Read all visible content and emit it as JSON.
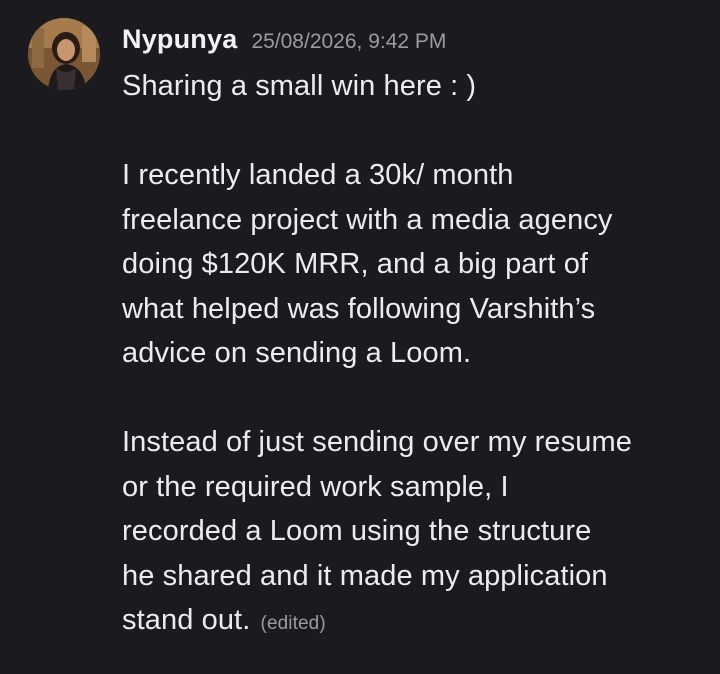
{
  "message": {
    "author": "Nypunya",
    "timestamp": "25/08/2026, 9:42 PM",
    "paragraphs": [
      [
        "Sharing a small win here : )"
      ],
      [
        "I recently landed a 30k/ month",
        "freelance project with a media agency",
        "doing $120K MRR, and a big part of",
        "what helped was following Varshith’s",
        "advice on sending a Loom."
      ],
      [
        "Instead of just sending over my resume",
        "or the required work sample, I",
        "recorded a Loom using the structure",
        "he shared and it made my application",
        "stand out."
      ]
    ],
    "edited_label": "(edited)"
  },
  "colors": {
    "background": "#1b1b1f",
    "text": "#ececf0",
    "muted": "#9a9aa3"
  },
  "icons": {
    "avatar": "user-avatar-photo"
  }
}
